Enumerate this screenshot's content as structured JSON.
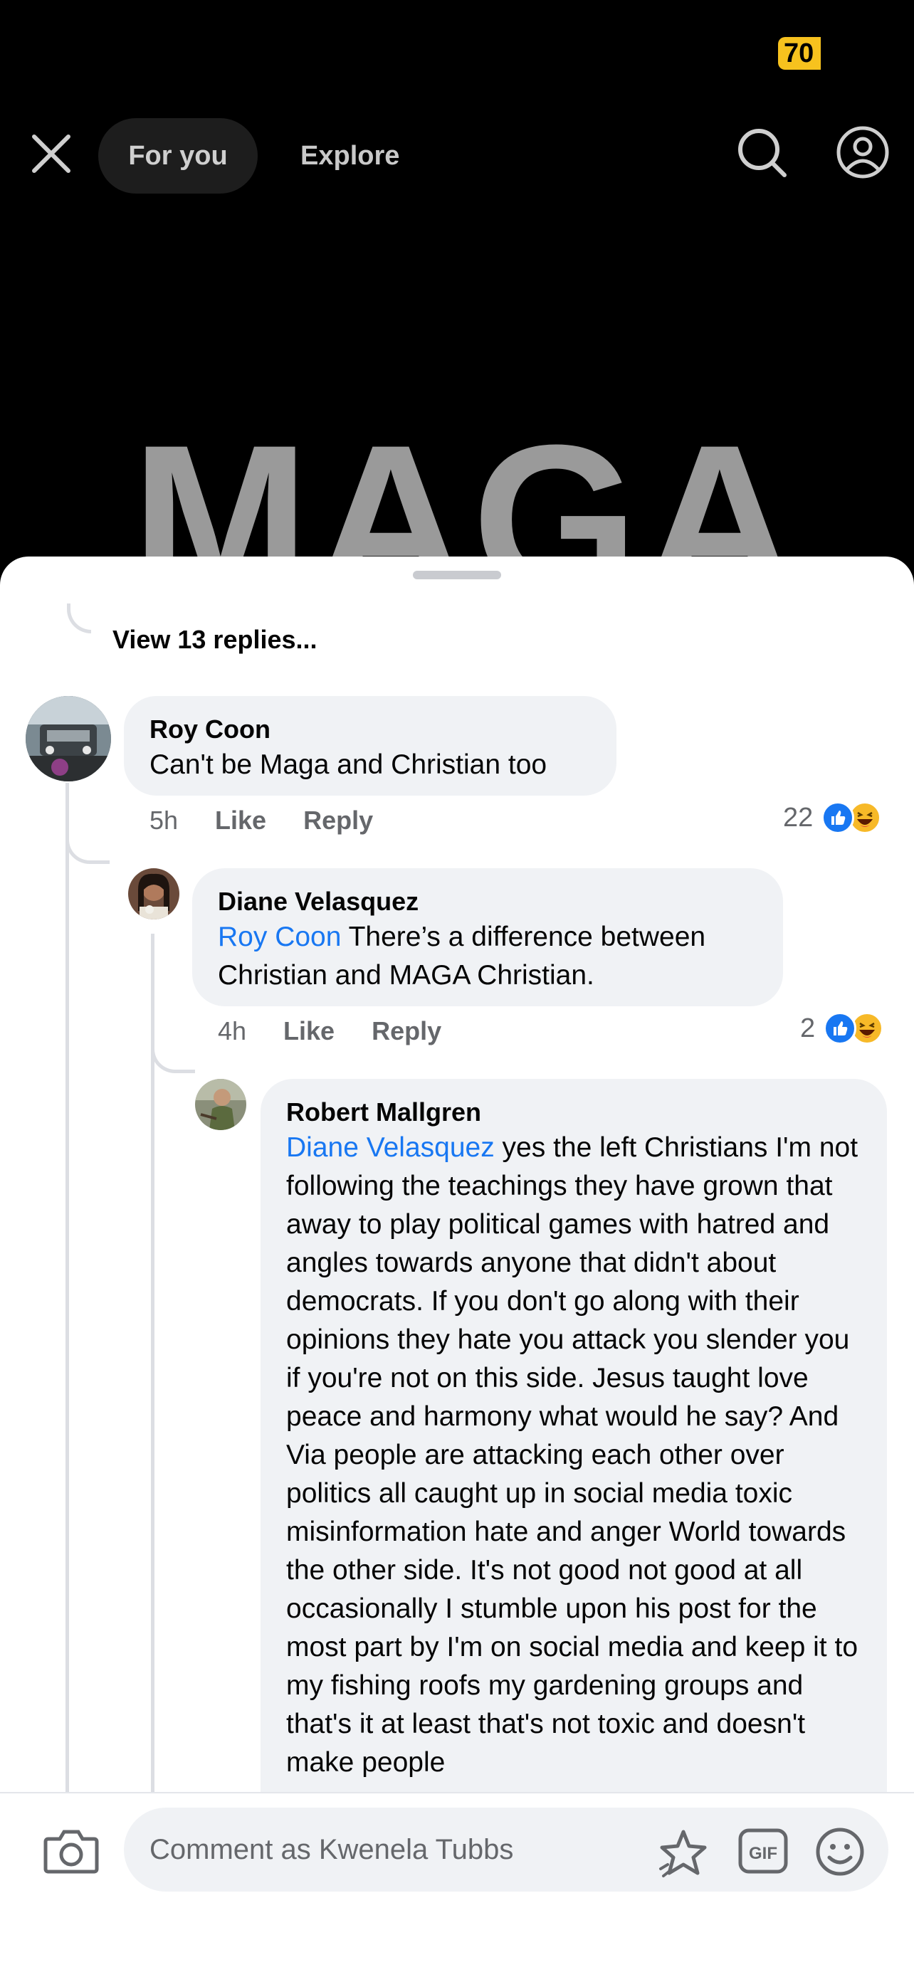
{
  "status_bar": {
    "battery": "70"
  },
  "nav": {
    "tabs": [
      {
        "label": "For you",
        "active": true
      },
      {
        "label": "Explore",
        "active": false
      }
    ]
  },
  "post": {
    "visible_text": "MAGA"
  },
  "comments": {
    "view_replies": "View 13 replies...",
    "items": [
      {
        "author": "Roy Coon",
        "text": "Can't be Maga and Christian too",
        "time": "5h",
        "like": "Like",
        "reply": "Reply",
        "reaction_count": "22"
      },
      {
        "author": "Diane Velasquez",
        "mention": "Roy Coon",
        "text": " There’s a difference between Christian and MAGA Christian.",
        "time": "4h",
        "like": "Like",
        "reply": "Reply",
        "reaction_count": "2"
      },
      {
        "author": "Robert Mallgren",
        "mention": "Diane Velasquez",
        "text": " yes the left Christians I'm not following the teachings they have grown that away to play political games with hatred and angles towards anyone that didn't about democrats. If you don't go along with their opinions they hate you attack you slender you if you're not on this side. Jesus taught love peace and harmony what would he say? And Via people are attacking each other over politics all caught up in social media toxic misinformation hate and anger World towards the other side. It's not good not good at all occasionally I stumble upon his post for the most part by I'm on social media and keep it to my fishing roofs my gardening groups and that's it at least that's not toxic and doesn't make people"
      }
    ]
  },
  "composer": {
    "placeholder": "Comment as Kwenela Tubbs"
  },
  "colors": {
    "accent": "#1877f2",
    "bubble": "#f0f2f5",
    "haha": "#f7b928",
    "battery": "#f7c21e"
  }
}
